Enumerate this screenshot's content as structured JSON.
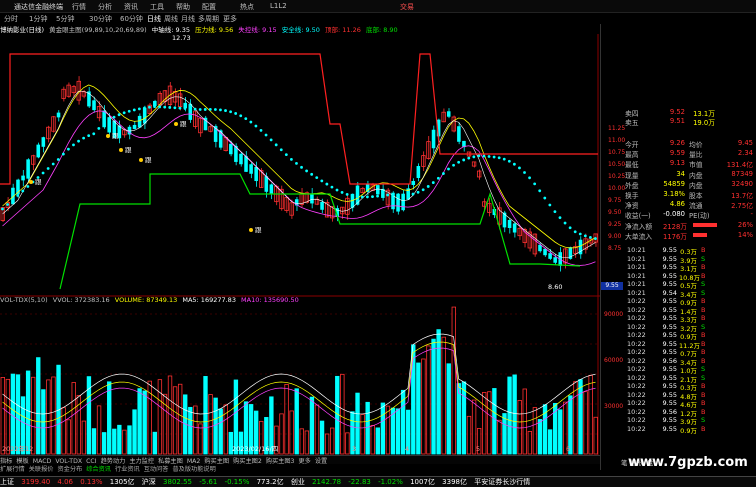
{
  "titlebar": {
    "app": "通达信金融终端",
    "menu": [
      "行情",
      "分析",
      "资讯",
      "工具",
      "帮助",
      "配置",
      "热点",
      "L1L2"
    ],
    "right": "交易"
  },
  "tabs": [
    "分时",
    "1分钟",
    "5分钟",
    "30分钟",
    "60分钟",
    "日线",
    "周线",
    "月线",
    "多周期",
    "更多"
  ],
  "info": {
    "title": "博纳影业(日线)",
    "indicator": "黄金眼主图(99,89,10,20,69,89)",
    "center": "中轴线: 9.35",
    "pressure": "压力线: 9.56",
    "loss": "失控线: 9.15",
    "safe": "安全线: 9.50",
    "topline": "顶部: 11.26",
    "bottom": "底部: 8.90"
  },
  "vol_info": {
    "name": "VOL-TDX(5,10)",
    "vvol": "VVOL: 372383.16",
    "volume": "VOLUME: 87349.13",
    "ma5": "MA5: 169277.83",
    "ma10": "MA10: 135690.50"
  },
  "annotations": {
    "high": "12.73",
    "low": "8.60",
    "marks": [
      "跟",
      "跟",
      "跟",
      "跟",
      "跟",
      "跟"
    ],
    "date1": "2022年12",
    "date2": "2023/02/16/四",
    "date3": "3",
    "date4": "4",
    "date5": "5",
    "date6": "6"
  },
  "price_ticks": [
    "11.25",
    "11.00",
    "10.75",
    "10.50",
    "10.25",
    "10.00",
    "9.75",
    "9.50",
    "9.25",
    "9.00",
    "8.75"
  ],
  "vol_ticks": [
    "90000",
    "60000",
    "30000"
  ],
  "bottom_tabs": [
    "指标",
    "模板",
    "MACD",
    "VOL-TDX",
    "CCI",
    "趋势动力",
    "主力监控",
    "私募主图",
    "MA2",
    "购买主图",
    "购买主图2",
    "购买主图3",
    "更多",
    "设置"
  ],
  "bottom_tabs2": [
    "扩展行情",
    "关联报价",
    "资金分布",
    "综合资讯",
    "行业资讯",
    "互动问答",
    "普及版功能说明"
  ],
  "statusbar": {
    "sh": "上证",
    "sh_val": "3199.40",
    "sh_chg": "4.06",
    "sh_pct": "0.13%",
    "sh_amt": "1305亿",
    "sz": "沪深",
    "sz_val": "3802.55",
    "sz_chg": "-5.61",
    "sz_pct": "-0.15%",
    "sz_amt": "773.2亿",
    "cy": "创业",
    "cy_val": "2142.78",
    "cy_chg": "-22.83",
    "cy_pct": "-1.02%",
    "cy_amt": "1007亿",
    "other_amt": "3398亿",
    "news": "平安证券长沙行情"
  },
  "quote": {
    "ask": [
      {
        "l": "卖四",
        "p": "9.52",
        "v": "13.1万"
      },
      {
        "l": "卖五",
        "p": "9.51",
        "v": "19.0万"
      }
    ],
    "stats": [
      {
        "l": "今开",
        "p": "9.26",
        "l2": "均价",
        "v": "9.45"
      },
      {
        "l": "最高",
        "p": "9.59",
        "l2": "量比",
        "v": "2.34"
      },
      {
        "l": "最低",
        "p": "9.13",
        "l2": "市值",
        "v": "131.4亿"
      },
      {
        "l": "现量",
        "p": "34",
        "l2": "内盘",
        "v": "87349"
      },
      {
        "l": "外盘",
        "p": "54859",
        "l2": "内盘",
        "v": "32490"
      },
      {
        "l": "换手",
        "p": "3.18%",
        "l2": "股本",
        "v": "13.7亿"
      },
      {
        "l": "净资",
        "p": "4.86",
        "l2": "流通",
        "v": "2.75亿"
      },
      {
        "l": "收益(一)",
        "p": "-0.080",
        "l2": "PE(动)",
        "v": "-"
      },
      {
        "l": "净流入额",
        "p": "2128万",
        "l2": "",
        "v": "26%"
      },
      {
        "l": "大单流入",
        "p": "1176万",
        "l2": "",
        "v": "14%"
      }
    ],
    "ticks": [
      {
        "t": "10:21",
        "p": "9.55",
        "v": "0.3万",
        "s": "B"
      },
      {
        "t": "10:21",
        "p": "9.55",
        "v": "3.9万",
        "s": "S"
      },
      {
        "t": "10:21",
        "p": "9.55",
        "v": "3.1万",
        "s": "B"
      },
      {
        "t": "10:21",
        "p": "9.55",
        "v": "10.8万",
        "s": "B"
      },
      {
        "t": "10:21",
        "p": "9.55",
        "v": "0.5万",
        "s": "S"
      },
      {
        "t": "10:21",
        "p": "9.54",
        "v": "3.4万",
        "s": "S"
      },
      {
        "t": "10:22",
        "p": "9.55",
        "v": "0.9万",
        "s": "B"
      },
      {
        "t": "10:22",
        "p": "9.55",
        "v": "1.4万",
        "s": "B"
      },
      {
        "t": "10:22",
        "p": "9.55",
        "v": "3.3万",
        "s": "B"
      },
      {
        "t": "10:22",
        "p": "9.55",
        "v": "3.2万",
        "s": "S"
      },
      {
        "t": "10:22",
        "p": "9.55",
        "v": "0.9万",
        "s": "B"
      },
      {
        "t": "10:22",
        "p": "9.55",
        "v": "11.2万",
        "s": "B"
      },
      {
        "t": "10:22",
        "p": "9.55",
        "v": "0.7万",
        "s": "B"
      },
      {
        "t": "10:22",
        "p": "9.56",
        "v": "3.4万",
        "s": "B"
      },
      {
        "t": "10:22",
        "p": "9.55",
        "v": "1.0万",
        "s": "S"
      },
      {
        "t": "10:22",
        "p": "9.55",
        "v": "2.1万",
        "s": "S"
      },
      {
        "t": "10:22",
        "p": "9.55",
        "v": "0.3万",
        "s": "B"
      },
      {
        "t": "10:22",
        "p": "9.55",
        "v": "4.8万",
        "s": "B"
      },
      {
        "t": "10:22",
        "p": "9.55",
        "v": "4.6万",
        "s": "B"
      },
      {
        "t": "10:22",
        "p": "9.56",
        "v": "1.2万",
        "s": "B"
      },
      {
        "t": "10:22",
        "p": "9.55",
        "v": "3.9万",
        "s": "S"
      },
      {
        "t": "10:22",
        "p": "9.55",
        "v": "0.9万",
        "s": "B"
      }
    ],
    "price_label": "9.55",
    "footer": "笔 细 价 盘"
  },
  "colors": {
    "up": "#ff3030",
    "down": "#00ffff",
    "ma": "#ffff00",
    "mid": "#ff40ff",
    "dots": "#00ffff",
    "safe": "#00e000",
    "top": "#ff2020"
  },
  "watermark": "www.7gpzb.com"
}
